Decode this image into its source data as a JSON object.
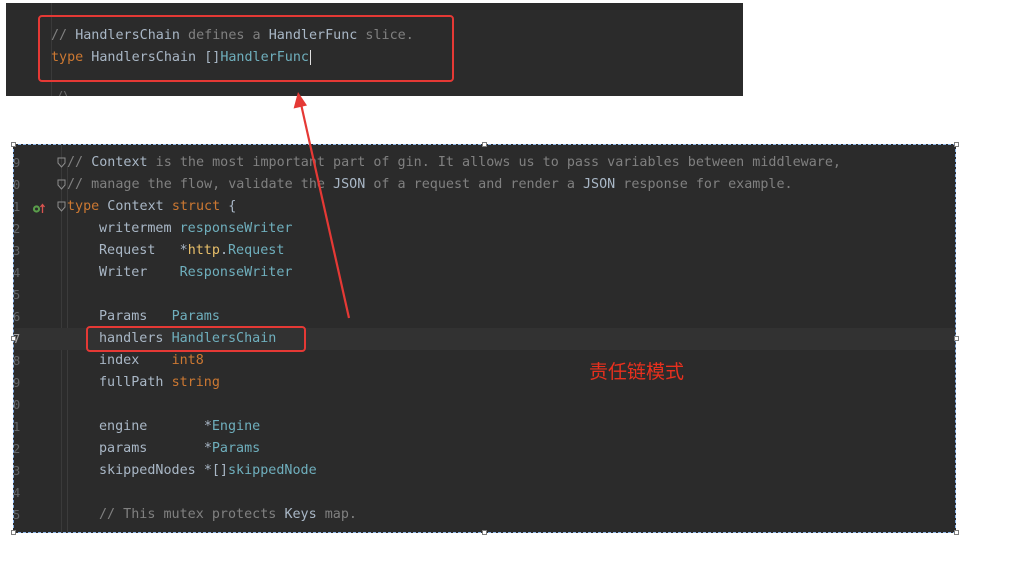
{
  "top_snippet": {
    "comment": {
      "slashes": "// ",
      "w1": "HandlersChain",
      "w2": " defines a ",
      "w3": "HandlerFunc",
      "w4": " slice."
    },
    "decl": {
      "kw": "type",
      "name": " HandlersChain ",
      "brackets": "[]",
      "type": "HandlerFunc"
    },
    "stub": "/\\"
  },
  "main_code": {
    "lines": [
      {
        "num": "9",
        "parts": [
          {
            "t": "// ",
            "c": "cm"
          },
          {
            "t": "Context",
            "c": "cmb"
          },
          {
            "t": " is the most important part of gin. It allows us to pass variables between middleware,",
            "c": "cm"
          }
        ]
      },
      {
        "num": "0",
        "parts": [
          {
            "t": "// manage the flow, validate the ",
            "c": "cm"
          },
          {
            "t": "JSON",
            "c": "cmb"
          },
          {
            "t": " of a request and render a ",
            "c": "cm"
          },
          {
            "t": "JSON",
            "c": "cmb"
          },
          {
            "t": " response for example.",
            "c": "cm"
          }
        ]
      },
      {
        "num": "1",
        "parts": [
          {
            "t": "type",
            "c": "kw"
          },
          {
            "t": " Context ",
            "c": "pl"
          },
          {
            "t": "struct",
            "c": "kw"
          },
          {
            "t": " {",
            "c": "pl"
          }
        ]
      },
      {
        "num": "2",
        "parts": [
          {
            "t": "writermem ",
            "c": "pl"
          },
          {
            "t": "responseWriter",
            "c": "ty"
          }
        ]
      },
      {
        "num": "3",
        "parts": [
          {
            "t": "Request   ",
            "c": "pl"
          },
          {
            "t": "*",
            "c": "op"
          },
          {
            "t": "http",
            "c": "pk"
          },
          {
            "t": ".",
            "c": "op"
          },
          {
            "t": "Request",
            "c": "ty"
          }
        ]
      },
      {
        "num": "4",
        "parts": [
          {
            "t": "Writer    ",
            "c": "pl"
          },
          {
            "t": "ResponseWriter",
            "c": "ty"
          }
        ]
      },
      {
        "num": "5",
        "parts": []
      },
      {
        "num": "6",
        "parts": [
          {
            "t": "Params   ",
            "c": "pl"
          },
          {
            "t": "Params",
            "c": "ty"
          }
        ]
      },
      {
        "num": "7",
        "parts": [
          {
            "t": "handlers ",
            "c": "pl"
          },
          {
            "t": "HandlersChain",
            "c": "ty"
          }
        ]
      },
      {
        "num": "8",
        "parts": [
          {
            "t": "index    ",
            "c": "pl"
          },
          {
            "t": "int8",
            "c": "kw"
          }
        ]
      },
      {
        "num": "9",
        "parts": [
          {
            "t": "fullPath ",
            "c": "pl"
          },
          {
            "t": "string",
            "c": "kw"
          }
        ]
      },
      {
        "num": "0",
        "parts": []
      },
      {
        "num": "1",
        "parts": [
          {
            "t": "engine       ",
            "c": "pl"
          },
          {
            "t": "*",
            "c": "op"
          },
          {
            "t": "Engine",
            "c": "ty"
          }
        ]
      },
      {
        "num": "2",
        "parts": [
          {
            "t": "params       ",
            "c": "pl"
          },
          {
            "t": "*",
            "c": "op"
          },
          {
            "t": "Params",
            "c": "ty"
          }
        ]
      },
      {
        "num": "3",
        "parts": [
          {
            "t": "skippedNodes ",
            "c": "pl"
          },
          {
            "t": "*[]",
            "c": "op"
          },
          {
            "t": "skippedNode",
            "c": "ty"
          }
        ]
      },
      {
        "num": "4",
        "parts": []
      },
      {
        "num": "5",
        "parts": [
          {
            "t": "// This mutex protects ",
            "c": "cm"
          },
          {
            "t": "Keys",
            "c": "cmb"
          },
          {
            "t": " map.",
            "c": "cm"
          }
        ]
      }
    ]
  },
  "annotation": {
    "label": "责任链模式"
  },
  "colors": {
    "editor_bg": "#2b2b2b",
    "annotation_red": "#e53935",
    "keyword": "#cc7832",
    "type": "#6fafbd",
    "comment": "#808080"
  }
}
